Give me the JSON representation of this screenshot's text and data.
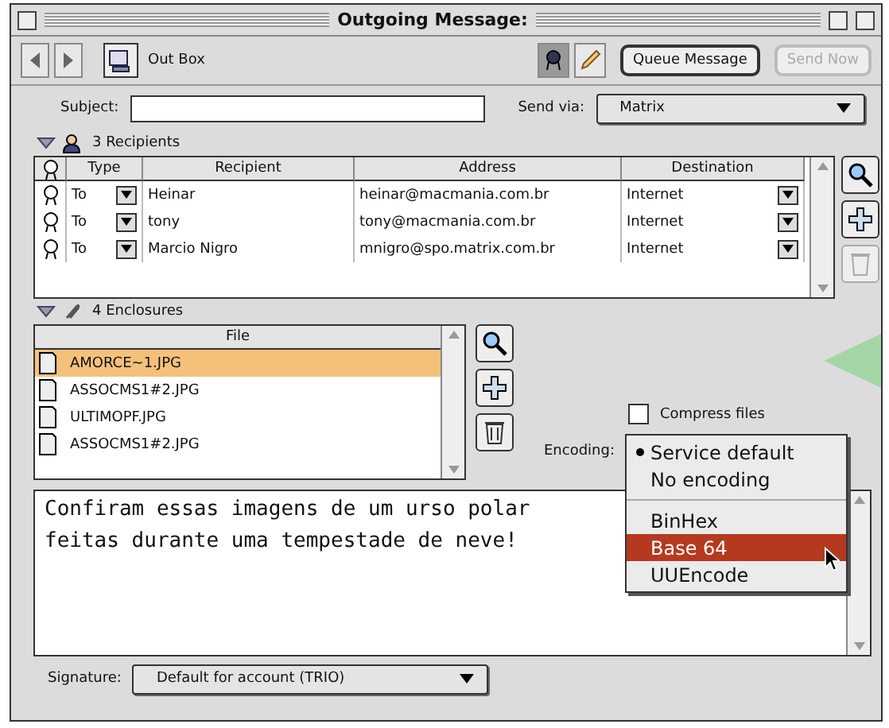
{
  "window": {
    "title": "Outgoing Message:"
  },
  "toolbar": {
    "mailbox": "Out Box",
    "buttons": [
      {
        "label": "Queue Message",
        "disabled": false
      },
      {
        "label": "Send Now",
        "disabled": true
      }
    ]
  },
  "subject": {
    "label": "Subject:"
  },
  "send_via": {
    "label": "Send via:",
    "value": "Matrix"
  },
  "recipients": {
    "summary": "3 Recipients",
    "expanded": true,
    "columns": [
      "Type",
      "Recipient",
      "Address",
      "Destination"
    ],
    "rows": [
      {
        "type": "To",
        "recipient": "Heinar",
        "address": "heinar@macmania.com.br",
        "destination": "Internet"
      },
      {
        "type": "To",
        "recipient": "tony",
        "address": "tony@macmania.com.br",
        "destination": "Internet"
      },
      {
        "type": "To",
        "recipient": "Marcio Nigro",
        "address": "mnigro@spo.matrix.com.br",
        "destination": "Internet"
      }
    ]
  },
  "enclosures": {
    "summary": "4 Enclosures",
    "expanded": true,
    "column": "File",
    "files": [
      {
        "name": "AMORCE~1.JPG",
        "selected": true
      },
      {
        "name": "ASSOCMS1#2.JPG",
        "selected": false
      },
      {
        "name": "ULTIMOPF.JPG",
        "selected": false
      },
      {
        "name": "ASSOCMS1#2.JPG",
        "selected": false
      }
    ]
  },
  "compress": {
    "label": "Compress files",
    "checked": false
  },
  "encoding": {
    "label": "Encoding:",
    "option_groups": [
      [
        {
          "label": "Service default",
          "checked": true,
          "selected": false
        },
        {
          "label": "No encoding",
          "checked": false,
          "selected": false
        }
      ],
      [
        {
          "label": "BinHex",
          "checked": false,
          "selected": false
        },
        {
          "label": "Base 64",
          "checked": false,
          "selected": true
        },
        {
          "label": "UUEncode",
          "checked": false,
          "selected": false
        }
      ]
    ]
  },
  "body": "Confiram essas imagens de um urso polar\nfeitas durante uma tempestade de neve!",
  "signature": {
    "label": "Signature:",
    "value": "Default for account (TRIO)"
  }
}
